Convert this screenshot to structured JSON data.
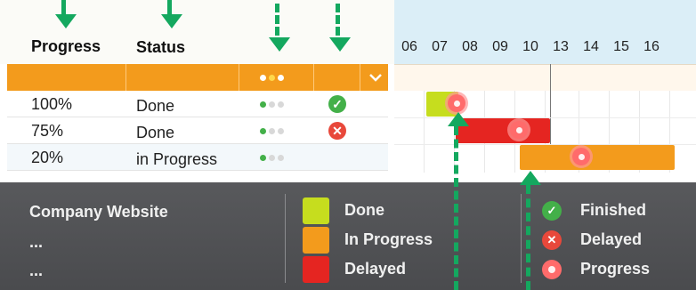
{
  "columns": {
    "progress": "Progress",
    "status": "Status"
  },
  "timeline_days": [
    "06",
    "07",
    "08",
    "09",
    "10",
    "13",
    "14",
    "15",
    "16"
  ],
  "tasks": [
    {
      "progress": "100%",
      "status": "Done",
      "dots_filled": 1,
      "status_icon": "check-icon"
    },
    {
      "progress": "75%",
      "status": "Done",
      "dots_filled": 1,
      "status_icon": "x-icon"
    },
    {
      "progress": "20%",
      "status": "in Progress",
      "dots_filled": 1,
      "status_icon": ""
    }
  ],
  "footer": {
    "project_title": "Company Website",
    "placeholder_1": "...",
    "placeholder_2": "...",
    "legend_colors": [
      {
        "label": "Done",
        "color": "#c6dd1e"
      },
      {
        "label": "In Progress",
        "color": "#f39b1c"
      },
      {
        "label": "Delayed",
        "color": "#e52521"
      }
    ],
    "legend_icons": [
      {
        "label": "Finished",
        "icon": "check-icon",
        "color": "#43b049"
      },
      {
        "label": "Delayed",
        "icon": "x-icon",
        "color": "#e8483b"
      },
      {
        "label": "Progress",
        "icon": "progress-dot-icon",
        "color": "#ff6b6b"
      }
    ]
  },
  "colors": {
    "accent_orange": "#f39b1c",
    "done_green": "#c6dd1e",
    "delayed_red": "#e52521",
    "annotation_green": "#14a85f"
  }
}
